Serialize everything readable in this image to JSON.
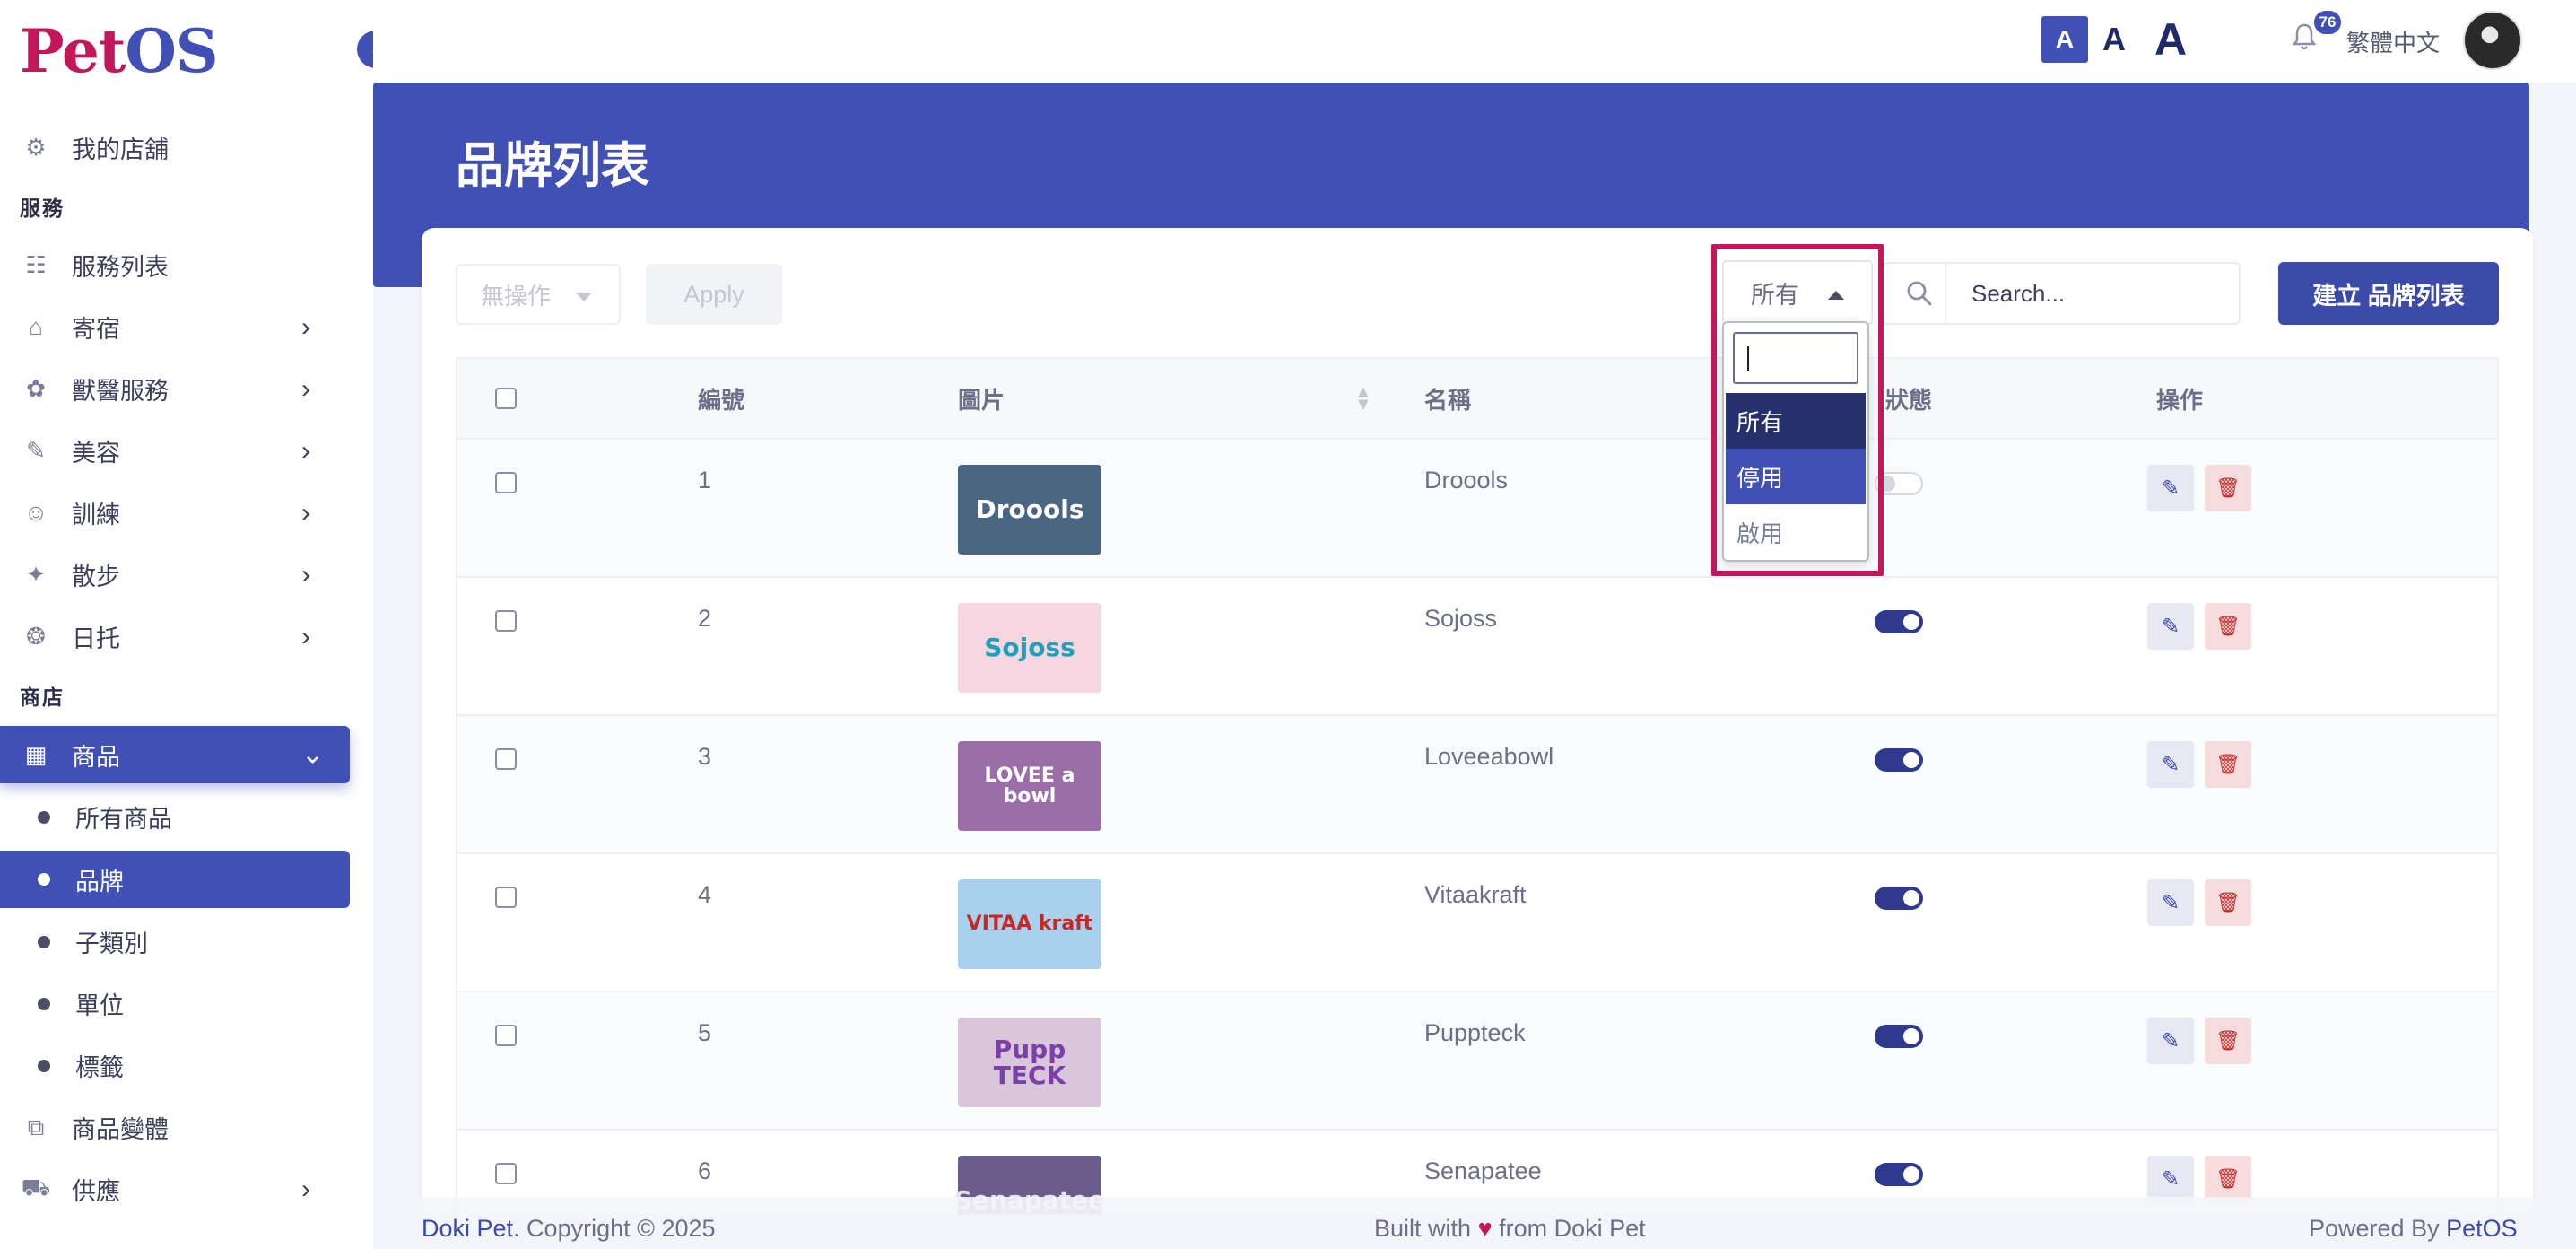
{
  "logo": {
    "pet": "Pet",
    "os": "OS"
  },
  "topbar": {
    "font_small": "A",
    "font_medium": "A",
    "font_large": "A",
    "notification_count": "76",
    "language": "繁體中文"
  },
  "sidebar": {
    "my_store": "我的店舖",
    "section_services": "服務",
    "service_items": [
      {
        "label": "服務列表",
        "icon": "list-icon",
        "expandable": false
      },
      {
        "label": "寄宿",
        "icon": "home-icon",
        "expandable": true
      },
      {
        "label": "獸醫服務",
        "icon": "paw-icon",
        "expandable": true
      },
      {
        "label": "美容",
        "icon": "brush-icon",
        "expandable": true
      },
      {
        "label": "訓練",
        "icon": "dog-head-icon",
        "expandable": true
      },
      {
        "label": "散步",
        "icon": "dog-walk-icon",
        "expandable": true
      },
      {
        "label": "日托",
        "icon": "daycare-icon",
        "expandable": true
      }
    ],
    "section_store": "商店",
    "products_label": "商品",
    "product_sub_items": [
      {
        "label": "所有商品",
        "active": false
      },
      {
        "label": "品牌",
        "active": true
      },
      {
        "label": "子類別",
        "active": false
      },
      {
        "label": "單位",
        "active": false
      },
      {
        "label": "標籤",
        "active": false
      }
    ],
    "product_variants": "商品變體",
    "supply": "供應"
  },
  "page": {
    "title": "品牌列表"
  },
  "toolbar": {
    "bulk_action": "無操作",
    "apply": "Apply",
    "status_filter": "所有",
    "search_placeholder": "Search...",
    "create_button": "建立 品牌列表"
  },
  "status_dropdown": {
    "options": [
      "所有",
      "停用",
      "啟用"
    ]
  },
  "table": {
    "headers": {
      "id": "編號",
      "image": "圖片",
      "name": "名稱",
      "status": "狀態",
      "actions": "操作"
    },
    "rows": [
      {
        "id": "1",
        "name": "Droools",
        "logo_text": "Droools",
        "logo_bg": "#4a6680",
        "logo_color": "#ffffff",
        "active": false
      },
      {
        "id": "2",
        "name": "Sojoss",
        "logo_text": "Sojoss",
        "logo_bg": "#f6d6e0",
        "logo_color": "#1fa0b8",
        "active": true
      },
      {
        "id": "3",
        "name": "Loveeabowl",
        "logo_text": "LOVEE a bowl",
        "logo_bg": "#9a6fa8",
        "logo_color": "#ffffff",
        "active": true
      },
      {
        "id": "4",
        "name": "Vitaakraft",
        "logo_text": "VITAA kraft",
        "logo_bg": "#a9d1ee",
        "logo_color": "#c62828",
        "active": true
      },
      {
        "id": "5",
        "name": "Puppteck",
        "logo_text": "Pupp TECK",
        "logo_bg": "#d9c6da",
        "logo_color": "#7b3fa8",
        "active": true
      },
      {
        "id": "6",
        "name": "Senapatee",
        "logo_text": "Senapatee",
        "logo_bg": "#6a5d8c",
        "logo_color": "#e6e0f0",
        "active": true
      }
    ]
  },
  "footer": {
    "brand": "Doki Pet",
    "copyright": ". Copyright © 2025",
    "built_prefix": "Built with",
    "heart": "♥",
    "built_suffix": "from Doki Pet",
    "powered_prefix": "Powered By",
    "powered_brand": "PetOS"
  },
  "colors": {
    "primary": "#4050b5",
    "primary_dark": "#26306b",
    "logo_pink": "#c2185b",
    "danger": "#c62828"
  }
}
